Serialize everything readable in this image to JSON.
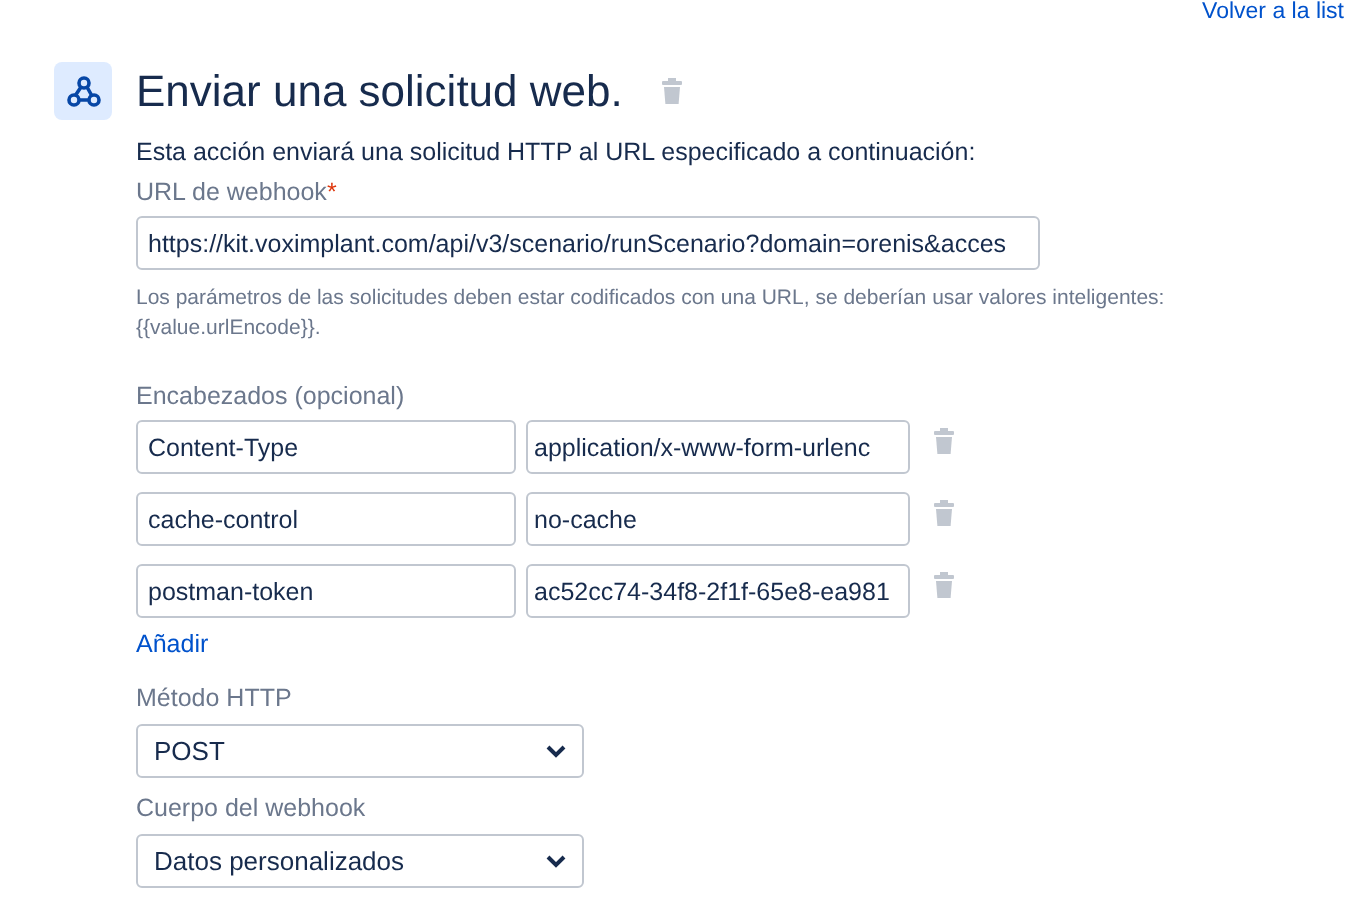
{
  "back_link": "Volver a la list",
  "action": {
    "title": "Enviar una solicitud web.",
    "description": "Esta acción enviará una solicitud HTTP al URL especificado a continuación:"
  },
  "url_field": {
    "label": "URL de webhook",
    "required_mark": "*",
    "value": "https://kit.voximplant.com/api/v3/scenario/runScenario?domain=orenis&acces"
  },
  "help_text": "Los parámetros de las solicitudes deben estar codificados con una URL, se deberían usar valores inteligentes: {{value.urlEncode}}.",
  "headers": {
    "label": "Encabezados (opcional)",
    "rows": [
      {
        "key": "Content-Type",
        "value": "application/x-www-form-urlenc"
      },
      {
        "key": "cache-control",
        "value": "no-cache"
      },
      {
        "key": "postman-token",
        "value": "ac52cc74-34f8-2f1f-65e8-ea981"
      }
    ],
    "add_link": "Añadir"
  },
  "method": {
    "label": "Método HTTP",
    "value": "POST"
  },
  "body": {
    "label": "Cuerpo del webhook",
    "value": "Datos personalizados"
  }
}
